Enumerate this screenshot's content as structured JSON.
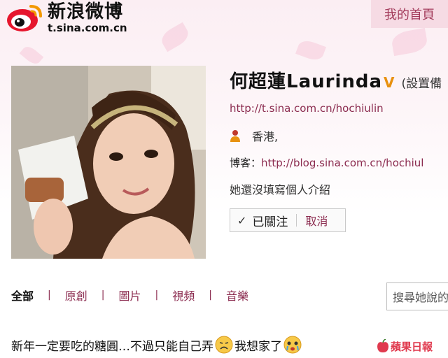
{
  "header": {
    "logo_cn": "新浪微博",
    "logo_url": "t.sina.com.cn",
    "home_link": "我的首頁"
  },
  "profile": {
    "name": "何超蓮Laurinda",
    "verified_mark": "V",
    "remark_link": "(設置備",
    "url": "http://t.sina.com.cn/hochiulin",
    "location": "香港,",
    "blog_label": "博客：",
    "blog_url": "http://blog.sina.com.cn/hochiul",
    "bio": "她還沒填寫個人介紹",
    "follow_status": "已關注",
    "cancel_label": "取消"
  },
  "tabs": [
    {
      "label": "全部",
      "active": true
    },
    {
      "label": "原創",
      "active": false
    },
    {
      "label": "圖片",
      "active": false
    },
    {
      "label": "視頻",
      "active": false
    },
    {
      "label": "音樂",
      "active": false
    }
  ],
  "tab_separator": "|",
  "search": {
    "placeholder": "搜尋她說的"
  },
  "post": {
    "text_part1": "新年一定要吃的糖圓…不過只能自己弄",
    "text_part2": "我想家了"
  },
  "watermark": "蘋果日報",
  "icons": {
    "logo": "sina-weibo-eye-icon",
    "verify": "verified-v-icon",
    "location": "person-icon",
    "follow": "check-icon",
    "emoji1": "sad-face-emoji-icon",
    "emoji2": "crying-face-emoji-icon",
    "watermark": "apple-icon"
  },
  "colors": {
    "link": "#8b2b4f",
    "verify": "#e8910f",
    "home_bg": "#f6dbe4",
    "watermark": "#e03a4e"
  }
}
